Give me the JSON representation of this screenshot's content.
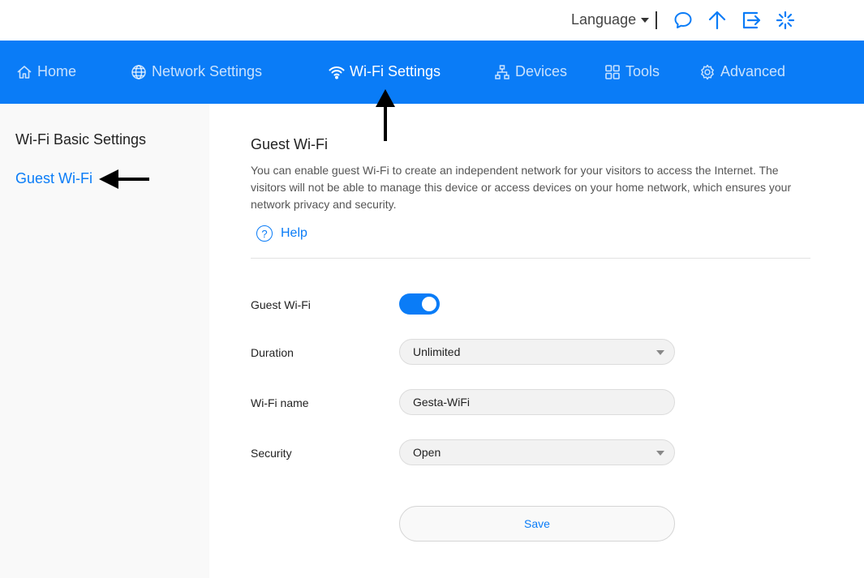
{
  "topbar": {
    "language_label": "Language",
    "icons": [
      "chat-icon",
      "upload-icon",
      "logout-icon",
      "loading-icon"
    ]
  },
  "nav": {
    "items": [
      {
        "label": "Home",
        "icon": "home-icon"
      },
      {
        "label": "Network Settings",
        "icon": "globe-icon"
      },
      {
        "label": "Wi-Fi Settings",
        "icon": "wifi-icon",
        "active": true
      },
      {
        "label": "Devices",
        "icon": "network-tree-icon"
      },
      {
        "label": "Tools",
        "icon": "grid-icon"
      },
      {
        "label": "Advanced",
        "icon": "gear-icon"
      }
    ]
  },
  "sidebar": {
    "items": [
      {
        "label": "Wi-Fi Basic Settings"
      },
      {
        "label": "Guest Wi-Fi",
        "active": true
      }
    ]
  },
  "main": {
    "title": "Guest Wi-Fi",
    "description": "You can enable guest Wi-Fi to create an independent network for your visitors to access the Internet. The visitors will not be able to manage this device or access devices on your home network, which ensures your network privacy and security.",
    "help_label": "Help",
    "form": {
      "guest_wifi_label": "Guest Wi-Fi",
      "guest_wifi_enabled": true,
      "duration_label": "Duration",
      "duration_value": "Unlimited",
      "wifi_name_label": "Wi-Fi name",
      "wifi_name_value": "Gesta-WiFi",
      "security_label": "Security",
      "security_value": "Open",
      "save_label": "Save"
    }
  },
  "colors": {
    "accent": "#0a7cf7",
    "sidebar_bg": "#f9f9f9"
  }
}
